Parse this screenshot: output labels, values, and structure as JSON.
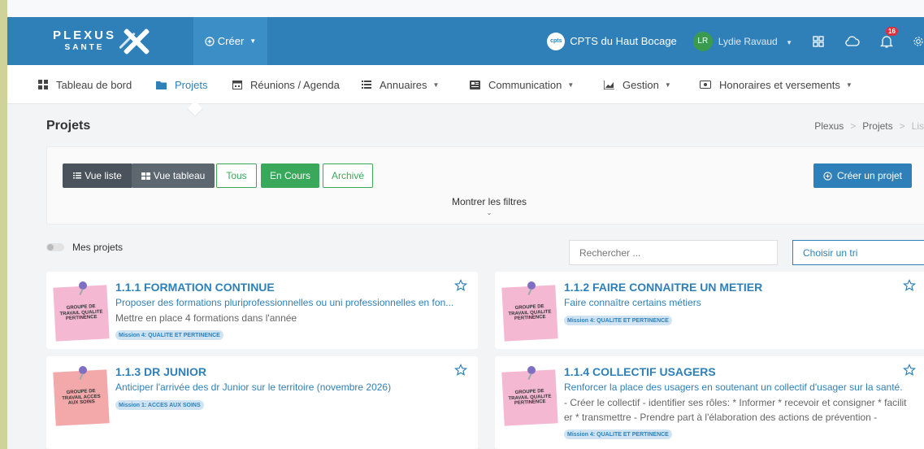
{
  "navbar": {
    "logo_line1": "PLEXUS",
    "logo_line2": "SANTE",
    "create_label": "Créer",
    "org_badge": "cpts",
    "org_name": "CPTS du Haut Bocage",
    "user_initials": "LR",
    "user_name": "Lydie Ravaud",
    "notification_count": "16",
    "colors": {
      "primary": "#2f80b8",
      "avatar": "#3a9b4f",
      "badge": "#e02f3c"
    }
  },
  "menu": {
    "items": [
      {
        "label": "Tableau de bord",
        "icon": "dashboard-icon"
      },
      {
        "label": "Projets",
        "icon": "folder-icon"
      },
      {
        "label": "Réunions / Agenda",
        "icon": "calendar-icon"
      },
      {
        "label": "Annuaires",
        "icon": "list-icon"
      },
      {
        "label": "Communication",
        "icon": "newspaper-icon"
      },
      {
        "label": "Gestion",
        "icon": "chart-icon"
      },
      {
        "label": "Honoraires et versements",
        "icon": "money-icon"
      }
    ]
  },
  "page": {
    "title": "Projets",
    "breadcrumb": [
      "Plexus",
      "Projets",
      "Liste"
    ]
  },
  "filters": {
    "view_list": "Vue liste",
    "view_table": "Vue tableau",
    "all": "Tous",
    "in_progress": "En Cours",
    "archived": "Archivé",
    "create_project": "Créer un projet",
    "show_filters": "Montrer les filtres"
  },
  "toolbar": {
    "my_projects": "Mes projets",
    "search_placeholder": "Rechercher ...",
    "sort_label": "Choisir un tri"
  },
  "projects": [
    {
      "title": "1.1.1 FORMATION CONTINUE",
      "subtitle": "Proposer des formations pluriprofessionnelles ou uni professionnelles en fon...",
      "description": "Mettre en place 4 formations dans l'année",
      "tag": "Mission 4: QUALITE ET PERTINENCE",
      "sticky": "GROUPE DE TRAVAIL QUALITE PERTINENCE"
    },
    {
      "title": "1.1.2 FAIRE CONNAITRE UN METIER",
      "subtitle": "Faire connaître certains métiers",
      "description": "",
      "tag": "Mission 4: QUALITE ET PERTINENCE",
      "sticky": "GROUPE DE TRAVAIL QUALITE PERTINENCE"
    },
    {
      "title": "1.1.3 DR JUNIOR",
      "subtitle": "Anticiper l'arrivée des dr Junior sur le territoire (novembre 2026)",
      "description": "",
      "tag": "Mission 1: ACCES AUX SOINS",
      "sticky": "GROUPE DE TRAVAIL ACCES AUX SOINS"
    },
    {
      "title": "1.1.4 COLLECTIF USAGERS",
      "subtitle": "Renforcer la place des usagers en soutenant un collectif d'usager sur la santé.",
      "description": "- Créer le collectif - identifier ses rôles: * Informer * recevoir et consigner * facilit er * transmettre - Prendre part à l'élaboration des actions de prévention - Porte...",
      "tag": "Mission 4: QUALITE ET PERTINENCE",
      "sticky": "GROUPE DE TRAVAIL QUALITE PERTINENCE"
    }
  ]
}
